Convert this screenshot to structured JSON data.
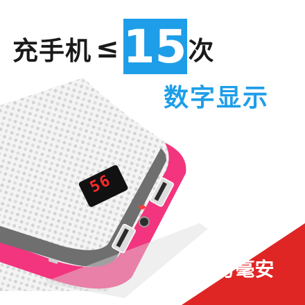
{
  "headline": {
    "prefix": "充手机",
    "symbol": "≤",
    "count": "15",
    "suffix": "次"
  },
  "subheadline": "数字显示",
  "display_reading": "56",
  "ribbon_text": "3万毫安",
  "colors": {
    "accent_blue": "#1e9ee8",
    "trim_pink": "#f2357e",
    "ribbon_red": "#e02525",
    "digit_red": "#ff2a2a"
  }
}
